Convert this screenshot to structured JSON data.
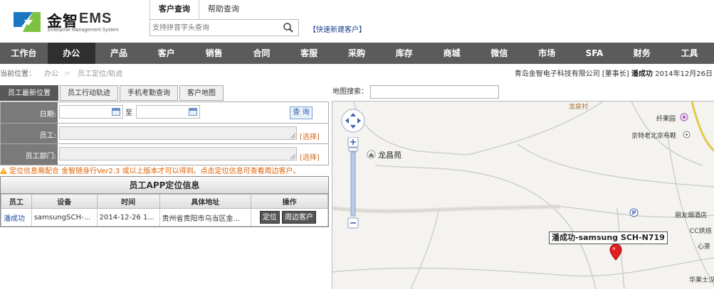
{
  "brand": {
    "logo_cn": "金智",
    "logo_ems": "EMS",
    "logo_sub": "Enterprise Management System",
    "colors": {
      "logo_blue": "#1a78c2",
      "logo_green": "#7cc242"
    }
  },
  "search": {
    "tabs": [
      "客户查询",
      "帮助查询"
    ],
    "placeholder": "支持拼音字头查询",
    "quick_new": "【快速新建客户】"
  },
  "nav": {
    "items": [
      "工作台",
      "办公",
      "产品",
      "客户",
      "销售",
      "合同",
      "客服",
      "采购",
      "库存",
      "商城",
      "微信",
      "市场",
      "SFA",
      "财务",
      "工具"
    ],
    "active_index": 1,
    "colors": {
      "bar": "#5b5b5b",
      "active": "#2f2f2f"
    }
  },
  "breadcrumb": {
    "label": "当前位置：",
    "level1": "办公",
    "level2": "员工定位/轨迹",
    "company": "青岛金智电子科技有限公司",
    "role": "[董事长]",
    "user": "潘成功",
    "date": "2014年12月26日"
  },
  "tabs": [
    "员工最新位置",
    "员工行动轨迹",
    "手机考勤查询",
    "客户地图"
  ],
  "form": {
    "date_label": "日期:",
    "to_label": "至",
    "query_btn": "查 询",
    "employee_label": "员工:",
    "dept_label": "员工部门:",
    "pick": "[选择]"
  },
  "warning": "定位信息需配合 金智随身行Ver2.3 或以上版本才可以得到。点击定位信息可查看周边客户。",
  "table": {
    "title": "员工APP定位信息",
    "headers": [
      "员工",
      "设备",
      "时间",
      "具体地址",
      "操作"
    ],
    "rows": [
      {
        "employee": "潘成功",
        "device": "samsungSCH-...",
        "time": "2014-12-26 1...",
        "address": "贵州省贵阳市乌当区金...",
        "btn_locate": "定位",
        "btn_nearby": "周边客户"
      }
    ]
  },
  "map": {
    "search_label": "地图搜索：",
    "marker_label": "潘成功-samsung SCH-N719",
    "pois": {
      "village": "龙泉村",
      "park": "纤果园",
      "store": "京特老北京布鞋",
      "garden": "龙昌苑",
      "hotel": "朋友烟酒店",
      "shop": "CC烘焙",
      "xin": "心茶",
      "hua": "华莱士汉"
    }
  }
}
